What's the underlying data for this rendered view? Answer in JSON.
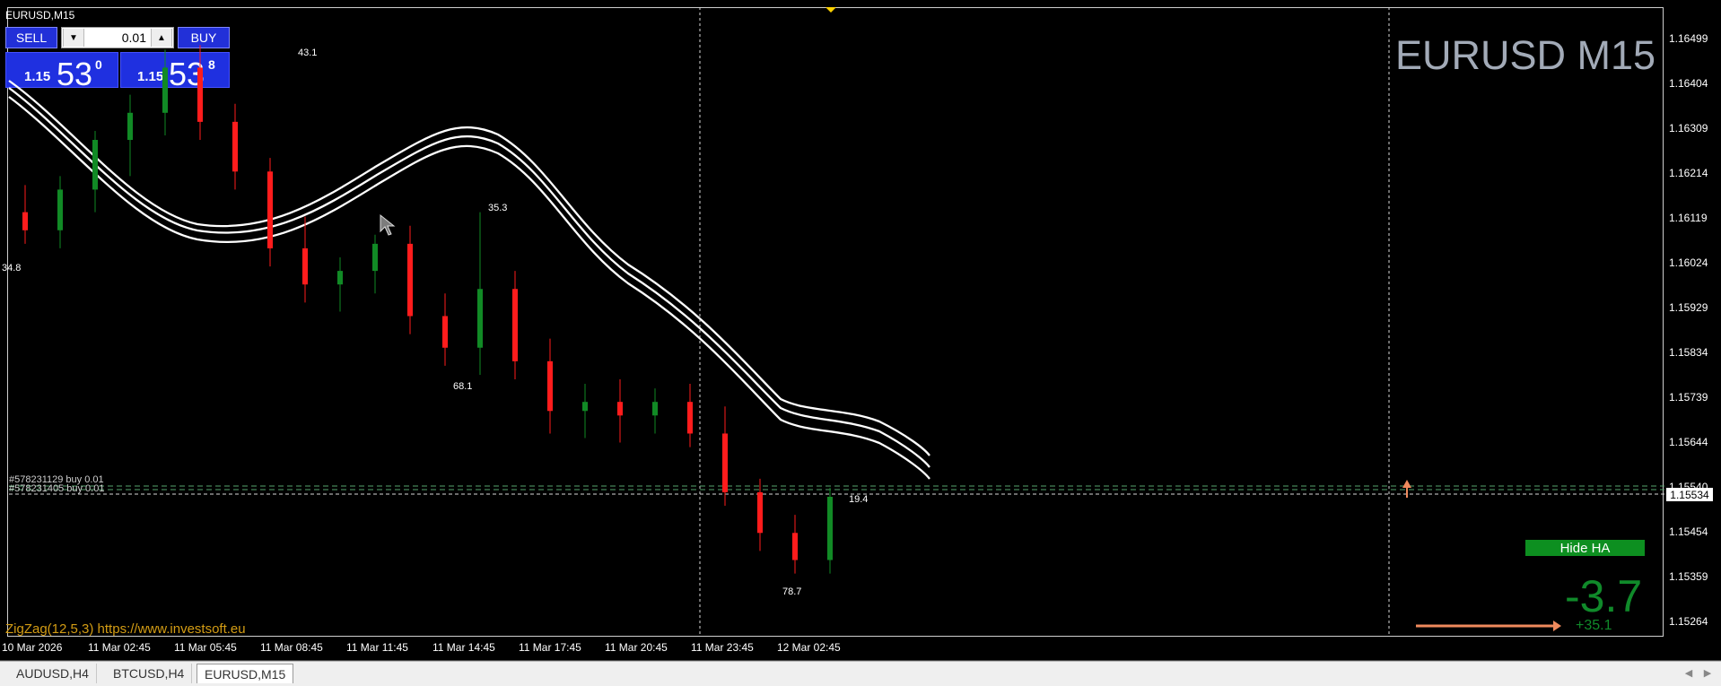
{
  "window": {
    "symbol_title": "EURUSD,M15",
    "big_label": "EURUSD M15"
  },
  "trade_panel": {
    "sell_label": "SELL",
    "buy_label": "BUY",
    "lot_value": "0.01",
    "bid": {
      "prefix": "1.15",
      "main": "53",
      "sup": "0"
    },
    "ask": {
      "prefix": "1.15",
      "main": "53",
      "sup": "8"
    }
  },
  "indicators": {
    "zigzag_label": "ZigZag(12,5,3) https://www.investsoft.eu",
    "hide_ha_label": "Hide HA",
    "value_big": "-3.7",
    "value_small": "+35.1",
    "zigzag_points": [
      "43.1",
      "35.3",
      "68.1",
      "78.7",
      "19.4",
      "34.8"
    ],
    "order_lines": [
      "#578231129 buy 0.01",
      "#578231405 buy 0.01"
    ]
  },
  "price_axis": {
    "labels": [
      "1.16499",
      "1.16404",
      "1.16309",
      "1.16214",
      "1.16119",
      "1.16024",
      "1.15929",
      "1.15834",
      "1.15739",
      "1.15644",
      "1.15540",
      "1.15454",
      "1.15359",
      "1.15264"
    ],
    "live_price": "1.15534"
  },
  "time_axis": {
    "labels": [
      "10 Mar 2026",
      "11 Mar 02:45",
      "11 Mar 05:45",
      "11 Mar 08:45",
      "11 Mar 11:45",
      "11 Mar 14:45",
      "11 Mar 17:45",
      "11 Mar 20:45",
      "11 Mar 23:45",
      "12 Mar 02:45"
    ]
  },
  "tabs": {
    "items": [
      "AUDUSD,H4",
      "BTCUSD,H4",
      "EURUSD,M15"
    ],
    "active_index": 2
  },
  "colors": {
    "background": "#000000",
    "bull": "#118a25",
    "bear": "#ff1c1c",
    "band": "#ffffff",
    "accent_blue": "#1f30e0",
    "accent_green": "#0d8f20",
    "accent_orange": "#f08a5d",
    "zigzag_text": "#d39c14"
  },
  "chart_data": {
    "type": "candlestick",
    "title": "EURUSD M15",
    "xlabel": "",
    "ylabel": "",
    "ylim": [
      1.1522,
      1.1655
    ],
    "x": [
      "10 Mar 2026",
      "11 Mar 02:45",
      "11 Mar 05:45",
      "11 Mar 08:45",
      "11 Mar 11:45",
      "11 Mar 14:45",
      "11 Mar 17:45",
      "11 Mar 20:45",
      "11 Mar 23:45",
      "12 Mar 02:45"
    ],
    "series": [
      {
        "type": "candles",
        "values": [
          {
            "o": 1.1612,
            "h": 1.1618,
            "l": 1.1605,
            "c": 1.1608
          },
          {
            "o": 1.1608,
            "h": 1.162,
            "l": 1.1604,
            "c": 1.1617
          },
          {
            "o": 1.1617,
            "h": 1.163,
            "l": 1.1612,
            "c": 1.1628
          },
          {
            "o": 1.1628,
            "h": 1.1638,
            "l": 1.162,
            "c": 1.1634
          },
          {
            "o": 1.1634,
            "h": 1.1648,
            "l": 1.1629,
            "c": 1.1644
          },
          {
            "o": 1.1644,
            "h": 1.1649,
            "l": 1.1628,
            "c": 1.1632
          },
          {
            "o": 1.1632,
            "h": 1.1636,
            "l": 1.1617,
            "c": 1.1621
          },
          {
            "o": 1.1621,
            "h": 1.1624,
            "l": 1.16,
            "c": 1.1604
          },
          {
            "o": 1.1604,
            "h": 1.1611,
            "l": 1.1592,
            "c": 1.1596
          },
          {
            "o": 1.1596,
            "h": 1.1602,
            "l": 1.159,
            "c": 1.1599
          },
          {
            "o": 1.1599,
            "h": 1.1607,
            "l": 1.1594,
            "c": 1.1605
          },
          {
            "o": 1.1605,
            "h": 1.1609,
            "l": 1.1585,
            "c": 1.1589
          },
          {
            "o": 1.1589,
            "h": 1.1594,
            "l": 1.1578,
            "c": 1.1582
          },
          {
            "o": 1.1582,
            "h": 1.1612,
            "l": 1.1576,
            "c": 1.1595
          },
          {
            "o": 1.1595,
            "h": 1.1599,
            "l": 1.1575,
            "c": 1.1579
          },
          {
            "o": 1.1579,
            "h": 1.1584,
            "l": 1.1563,
            "c": 1.1568
          },
          {
            "o": 1.1568,
            "h": 1.1574,
            "l": 1.1562,
            "c": 1.157
          },
          {
            "o": 1.157,
            "h": 1.1575,
            "l": 1.1561,
            "c": 1.1567
          },
          {
            "o": 1.1567,
            "h": 1.1573,
            "l": 1.1563,
            "c": 1.157
          },
          {
            "o": 1.157,
            "h": 1.1574,
            "l": 1.156,
            "c": 1.1563
          },
          {
            "o": 1.1563,
            "h": 1.1569,
            "l": 1.1547,
            "c": 1.155
          },
          {
            "o": 1.155,
            "h": 1.1553,
            "l": 1.1537,
            "c": 1.1541
          },
          {
            "o": 1.1541,
            "h": 1.1545,
            "l": 1.1532,
            "c": 1.1535
          },
          {
            "o": 1.1535,
            "h": 1.1551,
            "l": 1.1532,
            "c": 1.1549
          }
        ]
      }
    ],
    "grid": true,
    "legend": "none"
  }
}
